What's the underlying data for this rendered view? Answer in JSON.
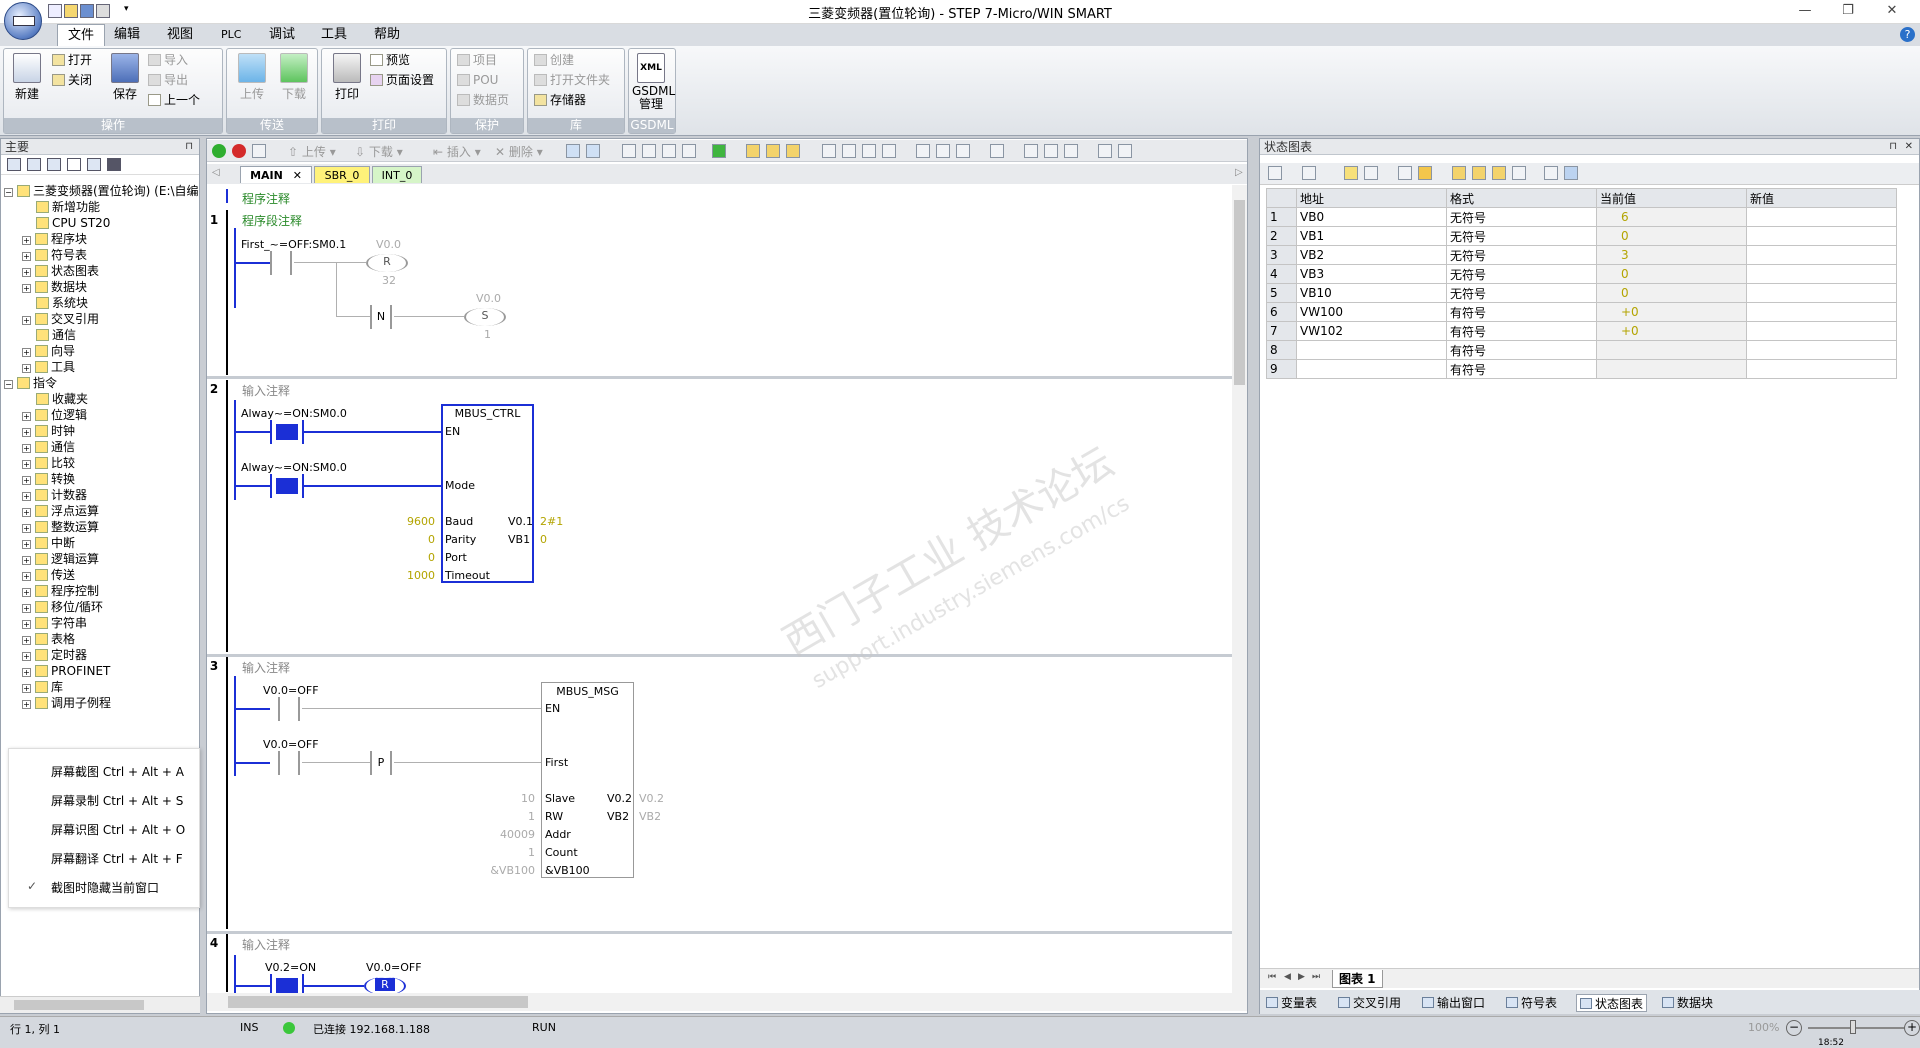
{
  "window": {
    "title": "三菱变频器(置位轮询) - STEP 7-Micro/WIN SMART",
    "min": "—",
    "max": "❐",
    "close": "✕"
  },
  "menu": {
    "items": [
      "文件",
      "编辑",
      "视图",
      "PLC",
      "调试",
      "工具",
      "帮助"
    ],
    "help": "?"
  },
  "ribbon": {
    "ops": {
      "label": "操作",
      "new": "新建",
      "open": "打开",
      "close": "关闭",
      "save": "保存",
      "import": "导入",
      "export": "导出",
      "prev": "上一个"
    },
    "transfer": {
      "label": "传送",
      "upload": "上传",
      "download": "下载"
    },
    "print": {
      "label": "打印",
      "print": "打印",
      "preview": "预览",
      "page": "页面设置"
    },
    "protect": {
      "label": "保护",
      "project": "项目",
      "pou": "POU",
      "datapage": "数据页"
    },
    "lib": {
      "label": "库",
      "create": "创建",
      "openfolder": "打开文件夹",
      "memory": "存储器"
    },
    "gsdml": {
      "label": "GSDML",
      "btn": "GSDML\n管理",
      "xml": "XML"
    }
  },
  "left": {
    "header": "主要",
    "tree": [
      {
        "t": "三菱变频器(置位轮询) (E:\\自编",
        "lv": 0,
        "ex": "−"
      },
      {
        "t": "新增功能",
        "lv": 1
      },
      {
        "t": "CPU ST20",
        "lv": 1
      },
      {
        "t": "程序块",
        "lv": 1,
        "ex": "+"
      },
      {
        "t": "符号表",
        "lv": 1,
        "ex": "+"
      },
      {
        "t": "状态图表",
        "lv": 1,
        "ex": "+"
      },
      {
        "t": "数据块",
        "lv": 1,
        "ex": "+"
      },
      {
        "t": "系统块",
        "lv": 1
      },
      {
        "t": "交叉引用",
        "lv": 1,
        "ex": "+"
      },
      {
        "t": "通信",
        "lv": 1
      },
      {
        "t": "向导",
        "lv": 1,
        "ex": "+"
      },
      {
        "t": "工具",
        "lv": 1,
        "ex": "+"
      },
      {
        "t": "指令",
        "lv": 0,
        "ex": "−"
      },
      {
        "t": "收藏夹",
        "lv": 1
      },
      {
        "t": "位逻辑",
        "lv": 1,
        "ex": "+"
      },
      {
        "t": "时钟",
        "lv": 1,
        "ex": "+"
      },
      {
        "t": "通信",
        "lv": 1,
        "ex": "+"
      },
      {
        "t": "比较",
        "lv": 1,
        "ex": "+"
      },
      {
        "t": "转换",
        "lv": 1,
        "ex": "+"
      },
      {
        "t": "计数器",
        "lv": 1,
        "ex": "+"
      },
      {
        "t": "浮点运算",
        "lv": 1,
        "ex": "+"
      },
      {
        "t": "整数运算",
        "lv": 1,
        "ex": "+"
      },
      {
        "t": "中断",
        "lv": 1,
        "ex": "+"
      },
      {
        "t": "逻辑运算",
        "lv": 1,
        "ex": "+"
      },
      {
        "t": "传送",
        "lv": 1,
        "ex": "+"
      },
      {
        "t": "程序控制",
        "lv": 1,
        "ex": "+"
      },
      {
        "t": "移位/循环",
        "lv": 1,
        "ex": "+"
      },
      {
        "t": "字符串",
        "lv": 1,
        "ex": "+"
      },
      {
        "t": "表格",
        "lv": 1,
        "ex": "+"
      },
      {
        "t": "定时器",
        "lv": 1,
        "ex": "+"
      },
      {
        "t": "PROFINET",
        "lv": 1,
        "ex": "+"
      },
      {
        "t": "库",
        "lv": 1,
        "ex": "+"
      },
      {
        "t": "调用子例程",
        "lv": 1,
        "ex": "+"
      }
    ]
  },
  "context_menu": [
    "屏幕截图 Ctrl + Alt + A",
    "屏幕录制 Ctrl + Alt + S",
    "屏幕识图 Ctrl + Alt + O",
    "屏幕翻译 Ctrl + Alt + F",
    "截图时隐藏当前窗口"
  ],
  "editor": {
    "toolbar": {
      "upload": "上传",
      "download": "下载",
      "insert": "插入",
      "delete": "删除"
    },
    "tabs": [
      "MAIN",
      "SBR_0",
      "INT_0"
    ],
    "program_comment": "程序注释",
    "networks": [
      {
        "n": "1",
        "comment": "程序段注释",
        "contact1": "First_~=OFF:SM0.1",
        "coilR_addr": "V0.0",
        "coilR": "R",
        "coilR_n": "32",
        "contactN": "N",
        "coilS_addr": "V0.0",
        "coilS": "S",
        "coilS_n": "1"
      },
      {
        "n": "2",
        "comment": "输入注释",
        "contact1": "Alway~=ON:SM0.0",
        "contact2": "Alway~=ON:SM0.0",
        "box": "MBUS_CTRL",
        "pins": [
          "EN",
          "Mode",
          "Baud",
          "Parity",
          "Port",
          "Timeout"
        ],
        "in_vals": [
          "9600",
          "0",
          "0",
          "1000"
        ],
        "out_pins": [
          "V0.1",
          "VB1"
        ],
        "out_vals": [
          "2#1",
          "0"
        ]
      },
      {
        "n": "3",
        "comment": "输入注释",
        "contact1": "V0.0=OFF",
        "contact2": "V0.0=OFF",
        "contactP": "P",
        "box": "MBUS_MSG",
        "pins": [
          "EN",
          "First",
          "Slave",
          "RW",
          "Addr",
          "Count",
          "&VB100"
        ],
        "in_vals": [
          "10",
          "1",
          "40009",
          "1",
          "&VB100"
        ],
        "out_pins": [
          "V0.2",
          "VB2"
        ],
        "out_vals": [
          "V0.2",
          "VB2"
        ]
      },
      {
        "n": "4",
        "comment": "输入注释",
        "contact1": "V0.2=ON",
        "coil_addr": "V0.0=OFF",
        "coil": "R"
      }
    ],
    "watermark1": "西门子工业 技术论坛",
    "watermark2": "support.industry.siemens.com/cs"
  },
  "status_chart": {
    "header": "状态图表",
    "columns": [
      "地址",
      "格式",
      "当前值",
      "新值"
    ],
    "rows": [
      {
        "n": "1",
        "addr": "VB0",
        "fmt": "无符号",
        "cur": "6",
        "new": ""
      },
      {
        "n": "2",
        "addr": "VB1",
        "fmt": "无符号",
        "cur": "0",
        "new": ""
      },
      {
        "n": "3",
        "addr": "VB2",
        "fmt": "无符号",
        "cur": "3",
        "new": ""
      },
      {
        "n": "4",
        "addr": "VB3",
        "fmt": "无符号",
        "cur": "0",
        "new": ""
      },
      {
        "n": "5",
        "addr": "VB10",
        "fmt": "无符号",
        "cur": "0",
        "new": ""
      },
      {
        "n": "6",
        "addr": "VW100",
        "fmt": "有符号",
        "cur": "+0",
        "new": ""
      },
      {
        "n": "7",
        "addr": "VW102",
        "fmt": "有符号",
        "cur": "+0",
        "new": ""
      },
      {
        "n": "8",
        "addr": "",
        "fmt": "有符号",
        "cur": "",
        "new": ""
      },
      {
        "n": "9",
        "addr": "",
        "fmt": "有符号",
        "cur": "",
        "new": ""
      }
    ],
    "sheet_tab": "图表 1"
  },
  "bottom_tabs": [
    "变量表",
    "交叉引用",
    "输出窗口",
    "符号表",
    "状态图表",
    "数据块"
  ],
  "statusbar": {
    "pos": "行 1, 列 1",
    "ins": "INS",
    "conn": "已连接 192.168.1.188",
    "run": "RUN",
    "zoom": "100%",
    "time": "18:52"
  }
}
